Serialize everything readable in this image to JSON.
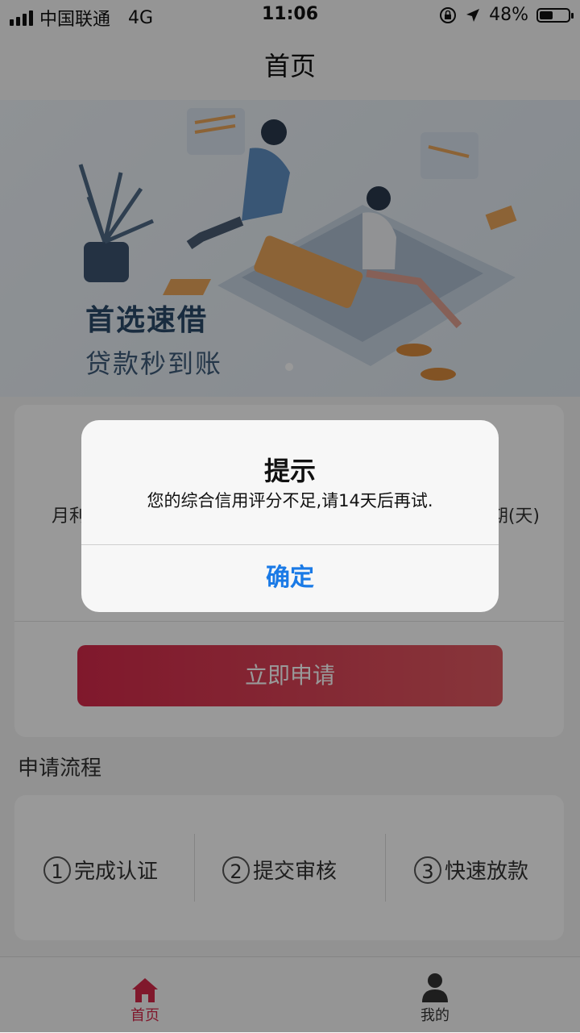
{
  "status_bar": {
    "carrier": "中国联通",
    "network": "4G",
    "time": "11:06",
    "battery": "48%",
    "battery_level": 0.48
  },
  "nav": {
    "title": "首页"
  },
  "banner": {
    "headline": "首选速借",
    "subline": "贷款秒到账"
  },
  "card": {
    "left_label": "月利",
    "right_label": "期(天)",
    "apply_button": "立即申请"
  },
  "process": {
    "title": "申请流程",
    "steps": [
      {
        "num": "1",
        "label": "完成认证"
      },
      {
        "num": "2",
        "label": "提交审核"
      },
      {
        "num": "3",
        "label": "快速放款"
      }
    ]
  },
  "tabbar": {
    "items": [
      {
        "label": "首页",
        "icon": "home-icon"
      },
      {
        "label": "我的",
        "icon": "user-icon"
      }
    ]
  },
  "dialog": {
    "title": "提示",
    "message": "您的综合信用评分不足,请14天后再试.",
    "confirm": "确定"
  },
  "colors": {
    "accent_red": "#d6294a",
    "link_blue": "#1a7ae6"
  }
}
